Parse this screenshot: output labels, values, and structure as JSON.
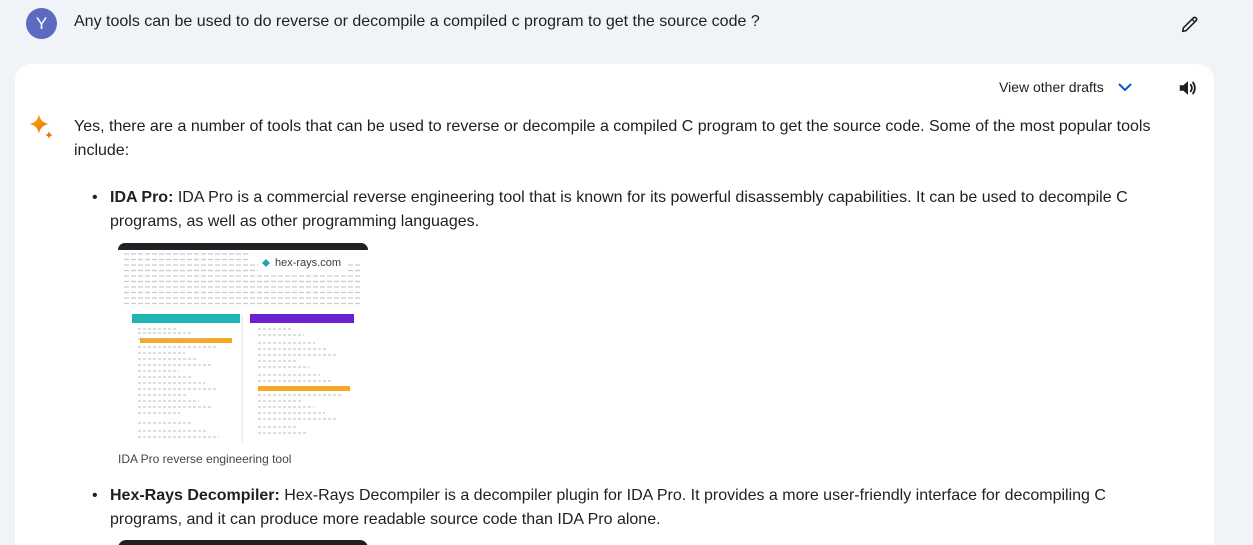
{
  "user": {
    "avatar_letter": "Y",
    "prompt": "Any tools can be used to do reverse or decompile a compiled c program to get the source code ?"
  },
  "toolbar": {
    "drafts_label": "View other drafts",
    "edit_icon": "pencil-icon",
    "speaker_icon": "speaker-icon",
    "chevron_icon": "chevron-down-icon"
  },
  "response": {
    "intro": "Yes, there are a number of tools that can be used to reverse or decompile a compiled C program to get the source code. Some of the most popular tools include:",
    "items": [
      {
        "name": "IDA Pro:",
        "text": " IDA Pro is a commercial reverse engineering tool that is known for its powerful disassembly capabilities. It can be used to decompile C programs, as well as other programming languages.",
        "image_source": "hex-rays.com",
        "image_caption": "IDA Pro reverse engineering tool"
      },
      {
        "name": "Hex-Rays Decompiler:",
        "text": " Hex-Rays Decompiler is a decompiler plugin for IDA Pro. It provides a more user-friendly interface for decompiling C programs, and it can produce more readable source code than IDA Pro alone."
      }
    ]
  },
  "colors": {
    "avatar": "#5c6bc0",
    "accent_blue": "#0b57d0",
    "page_bg": "#f0f4f9",
    "card_bg": "#ffffff",
    "teal_panel": "#1fb5b5",
    "purple_panel": "#6a1fd0",
    "highlight_orange": "#f9a825"
  }
}
